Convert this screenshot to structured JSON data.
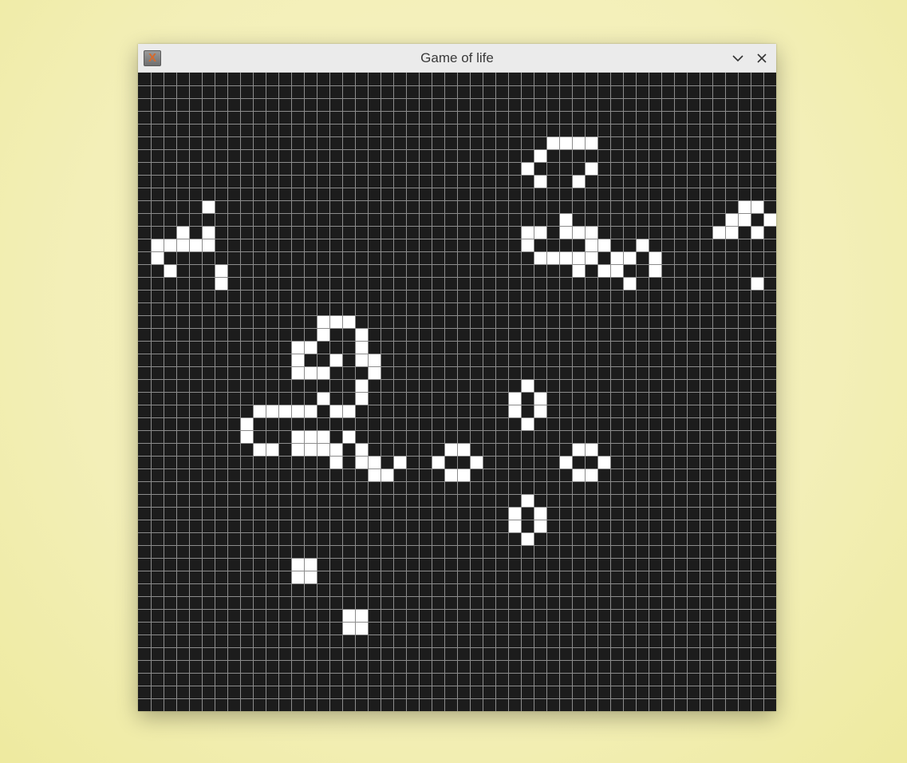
{
  "window": {
    "title": "Game of life",
    "icon": "x-app-icon",
    "buttons": [
      "minimize-chevron-icon",
      "close-icon"
    ]
  },
  "board": {
    "columns": 50,
    "rows": 50,
    "dead_color": "#1c1c1c",
    "live_color": "#ffffff",
    "grid_line_color": "#8c8c8c",
    "live_cells": [
      [
        32,
        5
      ],
      [
        33,
        5
      ],
      [
        34,
        5
      ],
      [
        35,
        5
      ],
      [
        31,
        6
      ],
      [
        30,
        7
      ],
      [
        35,
        7
      ],
      [
        31,
        8
      ],
      [
        34,
        8
      ],
      [
        5,
        10
      ],
      [
        47,
        10
      ],
      [
        48,
        10
      ],
      [
        3,
        12
      ],
      [
        5,
        12
      ],
      [
        33,
        11
      ],
      [
        46,
        11
      ],
      [
        47,
        11
      ],
      [
        49,
        11
      ],
      [
        2,
        13
      ],
      [
        3,
        13
      ],
      [
        4,
        13
      ],
      [
        5,
        13
      ],
      [
        30,
        12
      ],
      [
        31,
        12
      ],
      [
        33,
        12
      ],
      [
        34,
        12
      ],
      [
        35,
        12
      ],
      [
        30,
        13
      ],
      [
        35,
        13
      ],
      [
        36,
        13
      ],
      [
        39,
        13
      ],
      [
        45,
        12
      ],
      [
        46,
        12
      ],
      [
        48,
        12
      ],
      [
        1,
        13
      ],
      [
        1,
        14
      ],
      [
        31,
        14
      ],
      [
        32,
        14
      ],
      [
        33,
        14
      ],
      [
        34,
        14
      ],
      [
        35,
        14
      ],
      [
        37,
        14
      ],
      [
        38,
        14
      ],
      [
        40,
        14
      ],
      [
        2,
        15
      ],
      [
        6,
        15
      ],
      [
        34,
        15
      ],
      [
        36,
        15
      ],
      [
        37,
        15
      ],
      [
        40,
        15
      ],
      [
        6,
        16
      ],
      [
        38,
        16
      ],
      [
        48,
        16
      ],
      [
        14,
        19
      ],
      [
        15,
        19
      ],
      [
        16,
        19
      ],
      [
        14,
        20
      ],
      [
        17,
        20
      ],
      [
        12,
        21
      ],
      [
        13,
        21
      ],
      [
        17,
        21
      ],
      [
        12,
        22
      ],
      [
        15,
        22
      ],
      [
        17,
        22
      ],
      [
        18,
        22
      ],
      [
        12,
        23
      ],
      [
        13,
        23
      ],
      [
        14,
        23
      ],
      [
        18,
        23
      ],
      [
        17,
        24
      ],
      [
        30,
        24
      ],
      [
        14,
        25
      ],
      [
        17,
        25
      ],
      [
        29,
        25
      ],
      [
        31,
        25
      ],
      [
        9,
        26
      ],
      [
        10,
        26
      ],
      [
        11,
        26
      ],
      [
        12,
        26
      ],
      [
        13,
        26
      ],
      [
        15,
        26
      ],
      [
        16,
        26
      ],
      [
        29,
        26
      ],
      [
        31,
        26
      ],
      [
        8,
        27
      ],
      [
        30,
        27
      ],
      [
        8,
        28
      ],
      [
        12,
        28
      ],
      [
        13,
        28
      ],
      [
        14,
        28
      ],
      [
        16,
        28
      ],
      [
        9,
        29
      ],
      [
        10,
        29
      ],
      [
        12,
        29
      ],
      [
        13,
        29
      ],
      [
        14,
        29
      ],
      [
        15,
        29
      ],
      [
        17,
        29
      ],
      [
        24,
        29
      ],
      [
        25,
        29
      ],
      [
        34,
        29
      ],
      [
        35,
        29
      ],
      [
        15,
        30
      ],
      [
        17,
        30
      ],
      [
        18,
        30
      ],
      [
        20,
        30
      ],
      [
        23,
        30
      ],
      [
        26,
        30
      ],
      [
        33,
        30
      ],
      [
        36,
        30
      ],
      [
        18,
        31
      ],
      [
        19,
        31
      ],
      [
        24,
        31
      ],
      [
        25,
        31
      ],
      [
        34,
        31
      ],
      [
        35,
        31
      ],
      [
        30,
        33
      ],
      [
        29,
        34
      ],
      [
        31,
        34
      ],
      [
        29,
        35
      ],
      [
        31,
        35
      ],
      [
        30,
        36
      ],
      [
        12,
        38
      ],
      [
        13,
        38
      ],
      [
        12,
        39
      ],
      [
        13,
        39
      ],
      [
        16,
        42
      ],
      [
        17,
        42
      ],
      [
        16,
        43
      ],
      [
        17,
        43
      ]
    ]
  }
}
